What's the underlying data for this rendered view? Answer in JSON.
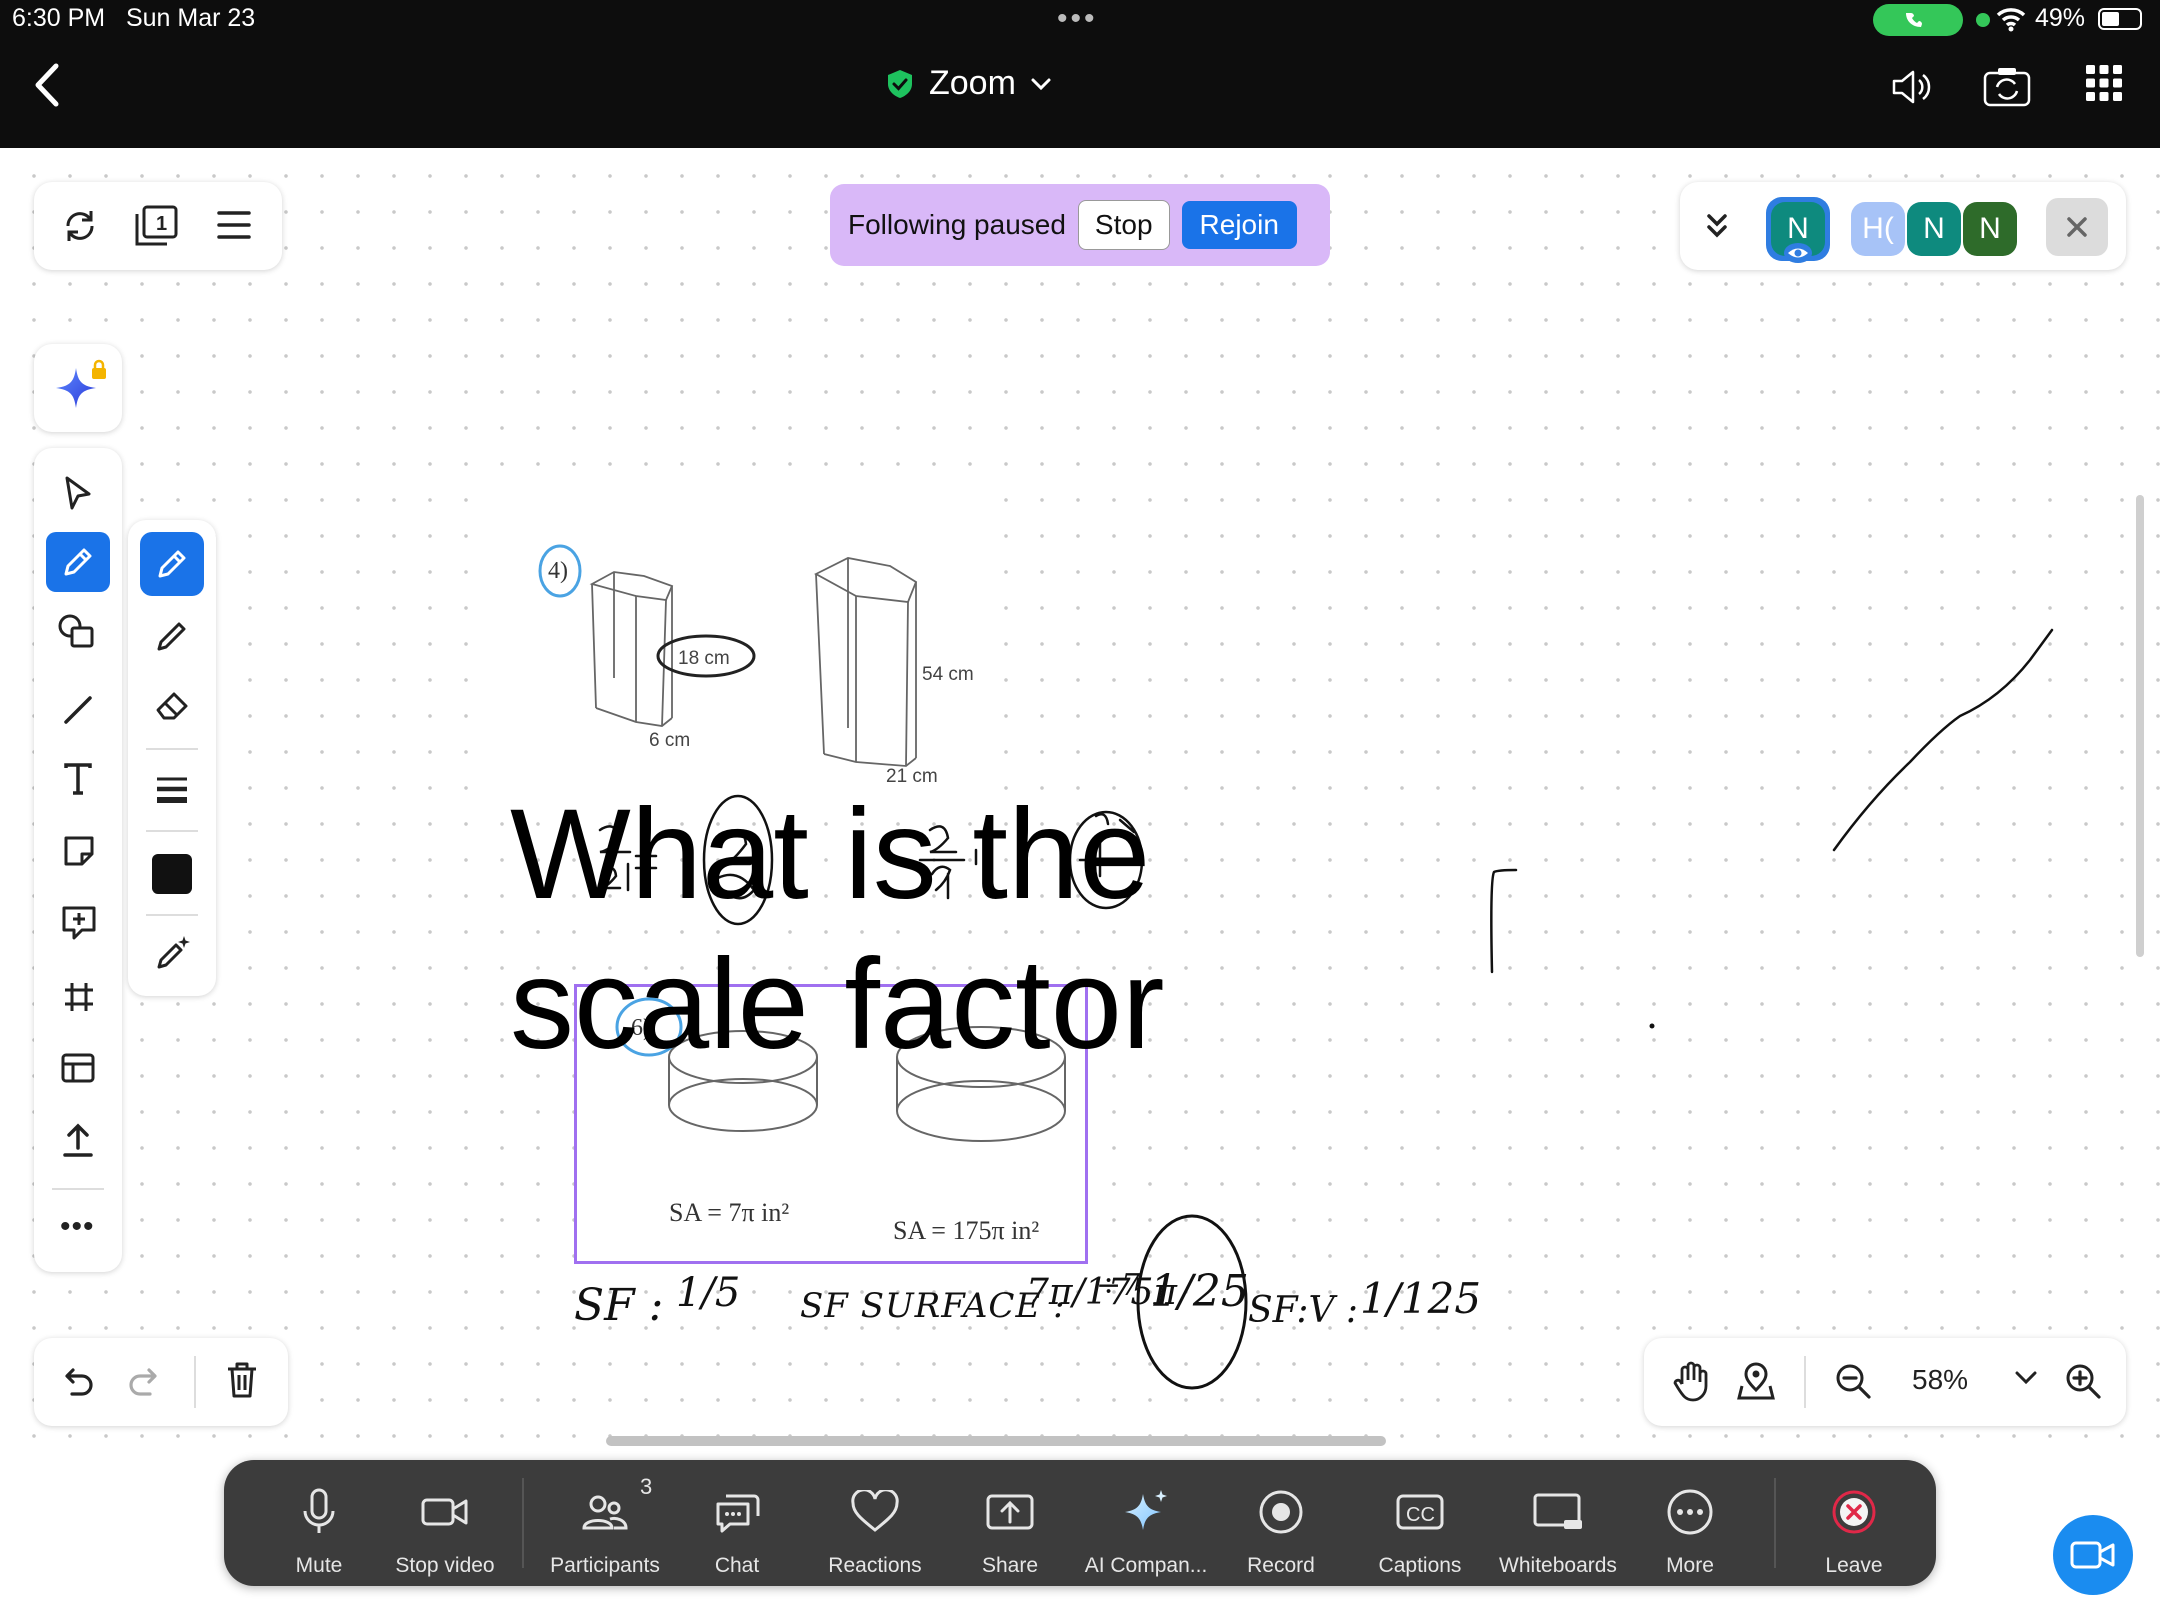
{
  "status_bar": {
    "time": "6:30 PM",
    "date": "Sun Mar 23",
    "battery": "49%"
  },
  "header": {
    "title": "Zoom"
  },
  "follow_banner": {
    "text": "Following paused",
    "stop": "Stop",
    "rejoin": "Rejoin"
  },
  "participants": {
    "avatars": [
      {
        "label": "N",
        "color": "#0e8a7e"
      },
      {
        "label": "H(",
        "color": "#a7c3f7"
      },
      {
        "label": "N",
        "color": "#0e8a7e"
      },
      {
        "label": "N",
        "color": "#2e6b2a"
      }
    ]
  },
  "whiteboard": {
    "text_box": [
      "What is the",
      "scale factor"
    ],
    "problem4": {
      "number": "4)",
      "small_height": "18 cm",
      "small_base": "6 cm",
      "large_height": "54 cm",
      "large_base": "21 cm"
    },
    "problem6": {
      "number": "6)",
      "sa_small": "SA = 7π in²",
      "sa_large": "SA = 175π in²"
    },
    "handwriting": {
      "sf": "SF :",
      "sf_value": "1/5",
      "sf_surface": "SF SURFACE :",
      "fraction": "7π/175π",
      "div": "÷7",
      "answer": "1/25",
      "sfv": "SF:V :",
      "sfv_value": "1/125"
    }
  },
  "zoom": {
    "level": "58%"
  },
  "dock": {
    "participants_count": "3",
    "items": [
      {
        "label": "Mute",
        "icon": "microphone-icon"
      },
      {
        "label": "Stop video",
        "icon": "video-camera-icon"
      },
      {
        "label": "Participants",
        "icon": "participants-icon"
      },
      {
        "label": "Chat",
        "icon": "chat-icon"
      },
      {
        "label": "Reactions",
        "icon": "heart-icon"
      },
      {
        "label": "Share",
        "icon": "share-icon"
      },
      {
        "label": "AI Compan...",
        "icon": "ai-sparkle-icon"
      },
      {
        "label": "Record",
        "icon": "record-icon"
      },
      {
        "label": "Captions",
        "icon": "cc-icon"
      },
      {
        "label": "Whiteboards",
        "icon": "whiteboard-icon"
      },
      {
        "label": "More",
        "icon": "more-icon"
      },
      {
        "label": "Leave",
        "icon": "leave-icon"
      }
    ]
  },
  "colors": {
    "accent": "#1a73e8",
    "banner": "#d9b8f8",
    "selection": "#a070f0",
    "leave": "#e02848"
  }
}
